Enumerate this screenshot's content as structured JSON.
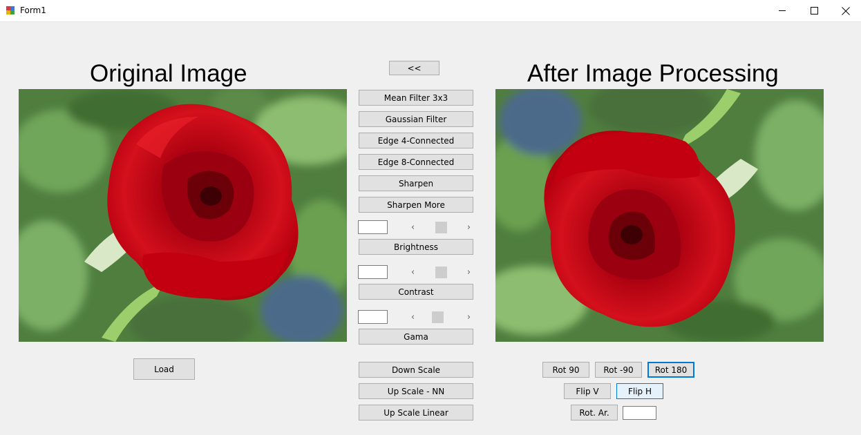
{
  "window": {
    "title": "Form1"
  },
  "headings": {
    "original": "Original Image",
    "processed": "After Image Processing"
  },
  "nav": {
    "back_label": "<<"
  },
  "filters": {
    "mean": "Mean Filter 3x3",
    "gaussian": "Gaussian Filter",
    "edge4": "Edge 4-Connected",
    "edge8": "Edge 8-Connected",
    "sharpen": "Sharpen",
    "sharpen_more": "Sharpen More"
  },
  "adjustments": {
    "brightness": {
      "label": "Brightness",
      "value": "",
      "level": 0.5
    },
    "contrast": {
      "label": "Contrast",
      "value": "",
      "level": 0.5
    },
    "gamma": {
      "label": "Gama",
      "value": "",
      "level": 0.4
    }
  },
  "scaling": {
    "down": "Down Scale",
    "up_nn": "Up Scale - NN",
    "up_linear": "Up Scale Linear"
  },
  "load_label": "Load",
  "transform": {
    "rot90": "Rot 90",
    "rot_minus90": "Rot -90",
    "rot180": "Rot 180",
    "flipv": "Flip V",
    "fliph": "Flip H",
    "rot_arbitrary": "Rot. Ar.",
    "angle_value": ""
  },
  "icons": {
    "app": "form-icon",
    "minimize": "minimize-icon",
    "maximize": "maximize-icon",
    "close": "close-icon",
    "arrow_left": "‹",
    "arrow_right": "›"
  },
  "colors": {
    "accent": "#0078d7",
    "button_bg": "#e1e1e1",
    "window_bg": "#f0f0f0"
  }
}
